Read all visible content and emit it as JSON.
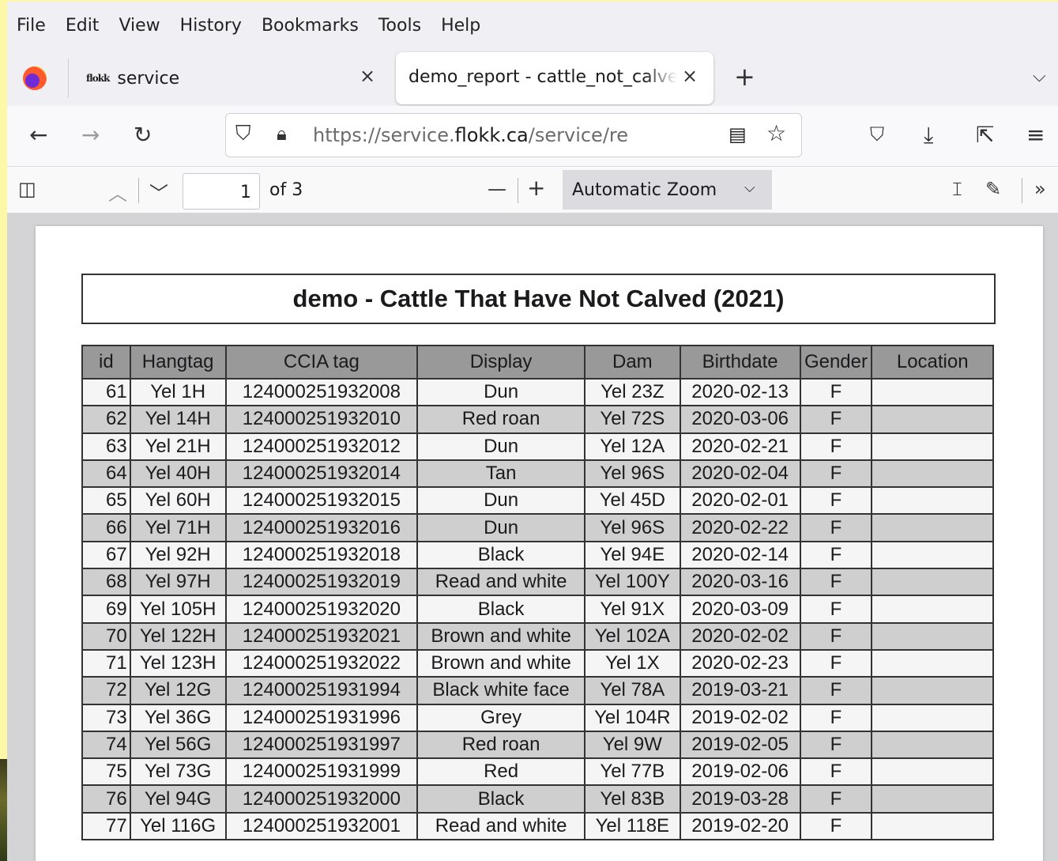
{
  "menu": [
    "File",
    "Edit",
    "View",
    "History",
    "Bookmarks",
    "Tools",
    "Help"
  ],
  "tabs": {
    "inactive_label": "service",
    "inactive_favicon": "flokk",
    "active_label": "demo_report - cattle_not_calved"
  },
  "url": {
    "prefix": "https://service.",
    "domain": "flokk.ca",
    "path": "/service/report/cattle"
  },
  "pdf": {
    "page": "1",
    "of": "of 3",
    "zoom": "Automatic Zoom"
  },
  "report": {
    "title": "demo - Cattle That Have Not Calved (2021)",
    "columns": [
      "id",
      "Hangtag",
      "CCIA tag",
      "Display",
      "Dam",
      "Birthdate",
      "Gender",
      "Location"
    ],
    "rows": [
      [
        "61",
        "Yel 1H",
        "124000251932008",
        "Dun",
        "Yel 23Z",
        "2020-02-13",
        "F",
        ""
      ],
      [
        "62",
        "Yel 14H",
        "124000251932010",
        "Red roan",
        "Yel 72S",
        "2020-03-06",
        "F",
        ""
      ],
      [
        "63",
        "Yel 21H",
        "124000251932012",
        "Dun",
        "Yel 12A",
        "2020-02-21",
        "F",
        ""
      ],
      [
        "64",
        "Yel 40H",
        "124000251932014",
        "Tan",
        "Yel 96S",
        "2020-02-04",
        "F",
        ""
      ],
      [
        "65",
        "Yel 60H",
        "124000251932015",
        "Dun",
        "Yel 45D",
        "2020-02-01",
        "F",
        ""
      ],
      [
        "66",
        "Yel 71H",
        "124000251932016",
        "Dun",
        "Yel 96S",
        "2020-02-22",
        "F",
        ""
      ],
      [
        "67",
        "Yel 92H",
        "124000251932018",
        "Black",
        "Yel 94E",
        "2020-02-14",
        "F",
        ""
      ],
      [
        "68",
        "Yel 97H",
        "124000251932019",
        "Read and white",
        "Yel 100Y",
        "2020-03-16",
        "F",
        ""
      ],
      [
        "69",
        "Yel 105H",
        "124000251932020",
        "Black",
        "Yel 91X",
        "2020-03-09",
        "F",
        ""
      ],
      [
        "70",
        "Yel 122H",
        "124000251932021",
        "Brown and white",
        "Yel 102A",
        "2020-02-02",
        "F",
        ""
      ],
      [
        "71",
        "Yel 123H",
        "124000251932022",
        "Brown and white",
        "Yel 1X",
        "2020-02-23",
        "F",
        ""
      ],
      [
        "72",
        "Yel 12G",
        "124000251931994",
        "Black white face",
        "Yel 78A",
        "2019-03-21",
        "F",
        ""
      ],
      [
        "73",
        "Yel 36G",
        "124000251931996",
        "Grey",
        "Yel 104R",
        "2019-02-02",
        "F",
        ""
      ],
      [
        "74",
        "Yel 56G",
        "124000251931997",
        "Red roan",
        "Yel 9W",
        "2019-02-05",
        "F",
        ""
      ],
      [
        "75",
        "Yel 73G",
        "124000251931999",
        "Red",
        "Yel 77B",
        "2019-02-06",
        "F",
        ""
      ],
      [
        "76",
        "Yel 94G",
        "124000251932000",
        "Black",
        "Yel 83B",
        "2019-03-28",
        "F",
        ""
      ],
      [
        "77",
        "Yel 116G",
        "124000251932001",
        "Read and white",
        "Yel 118E",
        "2019-02-20",
        "F",
        ""
      ]
    ]
  }
}
